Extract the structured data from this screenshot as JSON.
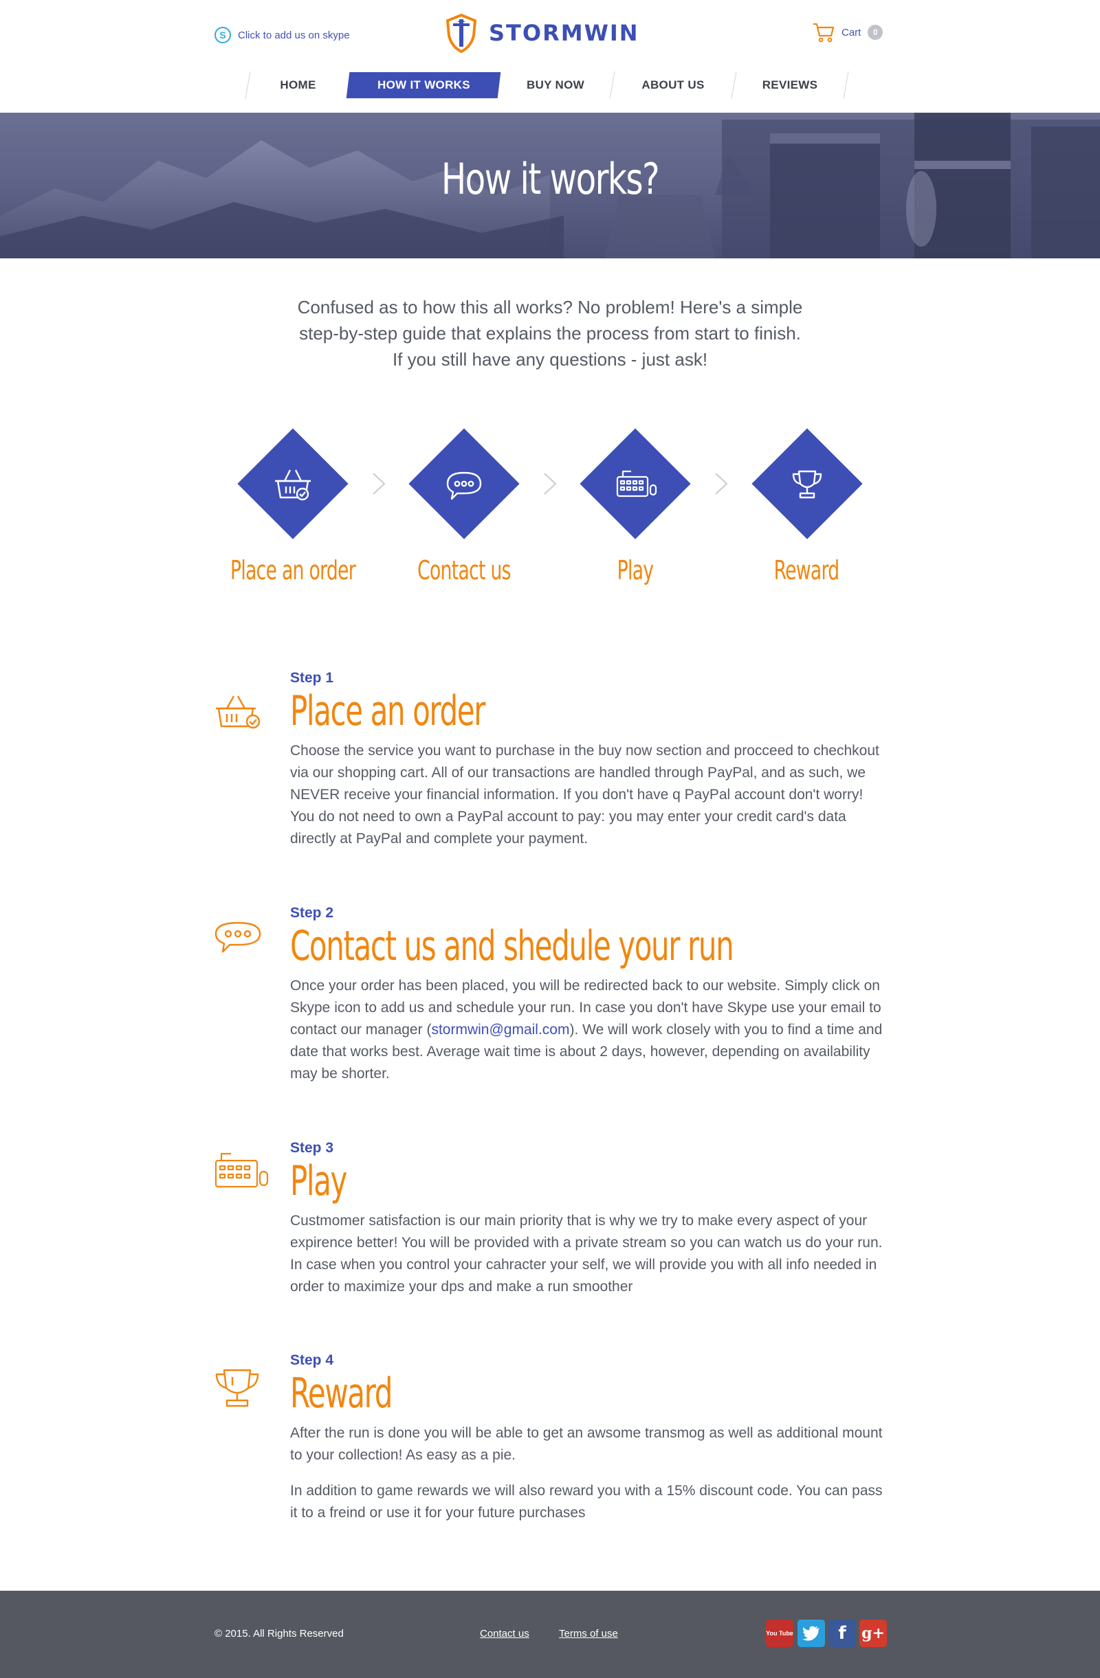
{
  "header": {
    "skype_text": "Click to add us on skype",
    "logo_text": "STORMWIN",
    "cart_label": "Cart",
    "cart_count": "0"
  },
  "nav": {
    "items": [
      {
        "label": "HOME"
      },
      {
        "label": "HOW IT WORKS",
        "active": true
      },
      {
        "label": "BUY NOW"
      },
      {
        "label": "ABOUT US"
      },
      {
        "label": "REVIEWS"
      }
    ]
  },
  "hero": {
    "title": "How it works?"
  },
  "intro": {
    "line1": "Confused as to how this all works? No problem! Here's a simple",
    "line2": "step-by-step guide that explains the process from start to finish.",
    "line3": "If you still have any questions - just ask!"
  },
  "process": [
    {
      "label": "Place an order",
      "icon": "basket-icon"
    },
    {
      "label": "Contact us",
      "icon": "chat-icon"
    },
    {
      "label": "Play",
      "icon": "keyboard-icon"
    },
    {
      "label": "Reward",
      "icon": "trophy-icon"
    }
  ],
  "steps": [
    {
      "num": "Step 1",
      "title": "Place an order",
      "text": "Choose the service you want to purchase in the buy now section and procceed to chechkout via our shopping cart. All of our transactions are handled through PayPal, and as such, we NEVER receive your financial information. If you don't have q PayPal account don't worry! You do not need to own a PayPal account to pay: you may enter your credit card's data directly at PayPal and complete your payment."
    },
    {
      "num": "Step 2",
      "title": "Contact us and shedule your run",
      "text_before": "Once your order has been placed, you will be redirected back to our website. Simply click on Skype icon to add us and schedule your run. In case you don't have Skype use your email to contact our manager (",
      "email": "stormwin@gmail.com",
      "text_after": "). We will work closely with you to find a time and date that works best. Average wait time is about 2 days, however, depending on availability may be shorter."
    },
    {
      "num": "Step 3",
      "title": "Play",
      "text": "Custmomer satisfaction is our main priority that is why we try to make every aspect of your expirence better! You will be provided with a private stream so you can watch us do your run. In case when you control your cahracter your self, we will provide you with all info needed in order to maximize your dps and make a run smoother"
    },
    {
      "num": "Step 4",
      "title": "Reward",
      "text": "After the run is done you will be able to get an awsome transmog as well as additional mount to your collection! As easy as a pie.",
      "text2": "In addition to game rewards we will also reward you with a 15% discount code. You can pass it to a freind or use it for your future purchases"
    }
  ],
  "footer": {
    "copyright": "© 2015. All Rights Reserved",
    "links": [
      "Contact us",
      "Terms of use"
    ],
    "social": [
      {
        "name": "youtube-icon",
        "label": "You Tube",
        "color": "#c4302b"
      },
      {
        "name": "twitter-icon",
        "label": "twitter",
        "color": "#2b9fdc"
      },
      {
        "name": "facebook-icon",
        "label": "f",
        "color": "#3b5998"
      },
      {
        "name": "google-plus-icon",
        "label": "g+",
        "color": "#d23b2e"
      }
    ]
  },
  "colors": {
    "brand_blue": "#3d4fb5",
    "accent_orange": "#f1860f",
    "footer_bg": "#555860"
  }
}
